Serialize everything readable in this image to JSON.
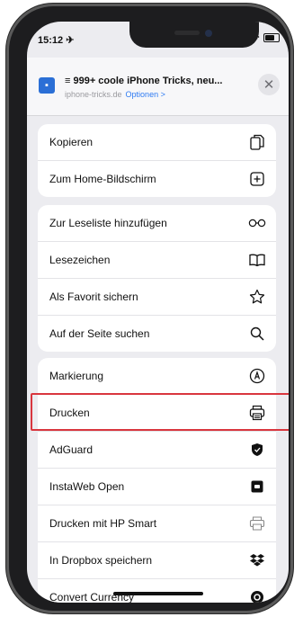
{
  "status_bar": {
    "time": "15:12 ✈"
  },
  "share_sheet": {
    "title": "≡ 999+ coole iPhone Tricks, neu...",
    "domain": "iphone-tricks.de",
    "options_label": "Optionen >",
    "close_symbol": "✕"
  },
  "groups": [
    {
      "items": [
        {
          "label": "Kopieren",
          "icon": "copy-icon"
        },
        {
          "label": "Zum Home-Bildschirm",
          "icon": "add-square-icon"
        }
      ]
    },
    {
      "items": [
        {
          "label": "Zur Leseliste hinzufügen",
          "icon": "glasses-icon"
        },
        {
          "label": "Lesezeichen",
          "icon": "book-icon"
        },
        {
          "label": "Als Favorit sichern",
          "icon": "star-icon"
        },
        {
          "label": "Auf der Seite suchen",
          "icon": "search-icon"
        }
      ]
    },
    {
      "items": [
        {
          "label": "Markierung",
          "icon": "markup-icon"
        },
        {
          "label": "Drucken",
          "icon": "printer-icon"
        },
        {
          "label": "AdGuard",
          "icon": "shield-icon"
        },
        {
          "label": "InstaWeb Open",
          "icon": "instaweb-icon"
        },
        {
          "label": "Drucken mit HP Smart",
          "icon": "hp-printer-icon"
        },
        {
          "label": "In Dropbox speichern",
          "icon": "dropbox-icon"
        },
        {
          "label": "Convert Currency",
          "icon": "currency-icon"
        }
      ]
    }
  ],
  "colors": {
    "accent": "#2f7bf2",
    "highlight_border": "#d9363e",
    "sheet_bg": "#ececf0"
  }
}
